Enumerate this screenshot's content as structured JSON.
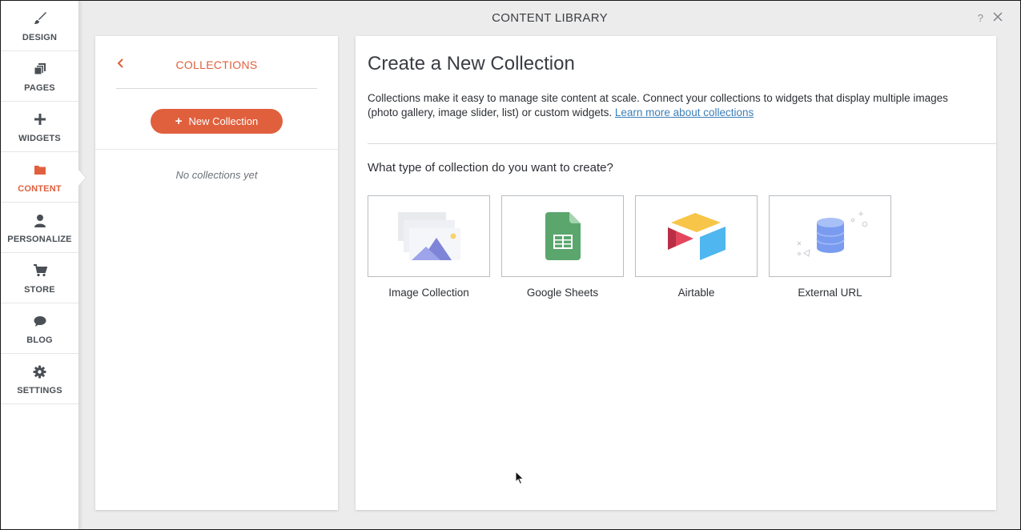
{
  "window": {
    "title": "CONTENT LIBRARY",
    "help_label": "?"
  },
  "nav": {
    "items": [
      {
        "label": "DESIGN",
        "icon": "paintbrush-icon"
      },
      {
        "label": "PAGES",
        "icon": "pages-icon"
      },
      {
        "label": "WIDGETS",
        "icon": "plus-icon"
      },
      {
        "label": "CONTENT",
        "icon": "folder-icon",
        "active": true
      },
      {
        "label": "PERSONALIZE",
        "icon": "person-icon"
      },
      {
        "label": "STORE",
        "icon": "cart-icon"
      },
      {
        "label": "BLOG",
        "icon": "speech-bubble-icon"
      },
      {
        "label": "SETTINGS",
        "icon": "gear-icon"
      }
    ]
  },
  "collections": {
    "title": "COLLECTIONS",
    "new_button": "New Collection",
    "empty_text": "No collections yet"
  },
  "main": {
    "heading": "Create a New Collection",
    "description": "Collections make it easy to manage site content at scale. Connect your collections to widgets that display multiple images (photo gallery, image slider, list) or custom widgets.",
    "learn_more": "Learn more about collections",
    "question": "What type of collection do you want to create?",
    "types": [
      {
        "label": "Image Collection",
        "icon": "image-collection-icon"
      },
      {
        "label": "Google Sheets",
        "icon": "google-sheets-icon"
      },
      {
        "label": "Airtable",
        "icon": "airtable-icon"
      },
      {
        "label": "External URL",
        "icon": "database-icon"
      }
    ]
  },
  "colors": {
    "accent": "#e0603d",
    "link": "#3d7fb8",
    "nav_text": "#4a4f55"
  }
}
